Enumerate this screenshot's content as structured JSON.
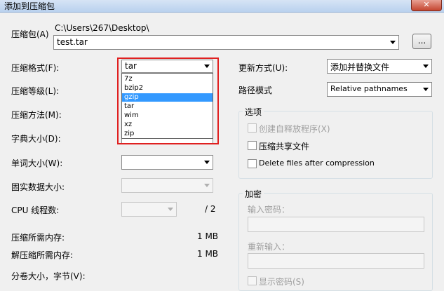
{
  "window": {
    "title": "添加到压缩包",
    "close_glyph": "✕"
  },
  "archive": {
    "label": "压缩包(A)",
    "path": "C:\\Users\\267\\Desktop\\",
    "filename": "test.tar",
    "browse_label": "..."
  },
  "format": {
    "label": "压缩格式(F):",
    "value": "tar",
    "options": [
      "7z",
      "bzip2",
      "gzip",
      "tar",
      "wim",
      "xz",
      "zip"
    ],
    "highlighted": "gzip"
  },
  "level": {
    "label": "压缩等级(L):"
  },
  "method": {
    "label": "压缩方法(M):"
  },
  "dict": {
    "label": "字典大小(D):"
  },
  "word": {
    "label": "单词大小(W):"
  },
  "solid": {
    "label": "固实数据大小:"
  },
  "threads": {
    "label": "CPU 线程数:",
    "total": "/ 2"
  },
  "memory": {
    "compress_label": "压缩所需内存:",
    "compress_value": "1 MB",
    "decompress_label": "解压缩所需内存:",
    "decompress_value": "1 MB"
  },
  "split": {
    "label": "分卷大小，字节(V):"
  },
  "update": {
    "label": "更新方式(U):",
    "value": "添加并替换文件"
  },
  "pathmode": {
    "label": "路径模式",
    "value": "Relative pathnames"
  },
  "options": {
    "title": "选项",
    "sfx": "创建自释放程序(X)",
    "shared": "压缩共享文件",
    "delete": "Delete files after compression"
  },
  "encryption": {
    "title": "加密",
    "password_label": "输入密码：",
    "reenter_label": "重新输入：",
    "show_password": "显示密码(S)"
  },
  "colors": {
    "highlight_box": "#e02020",
    "selection": "#3399ff"
  }
}
